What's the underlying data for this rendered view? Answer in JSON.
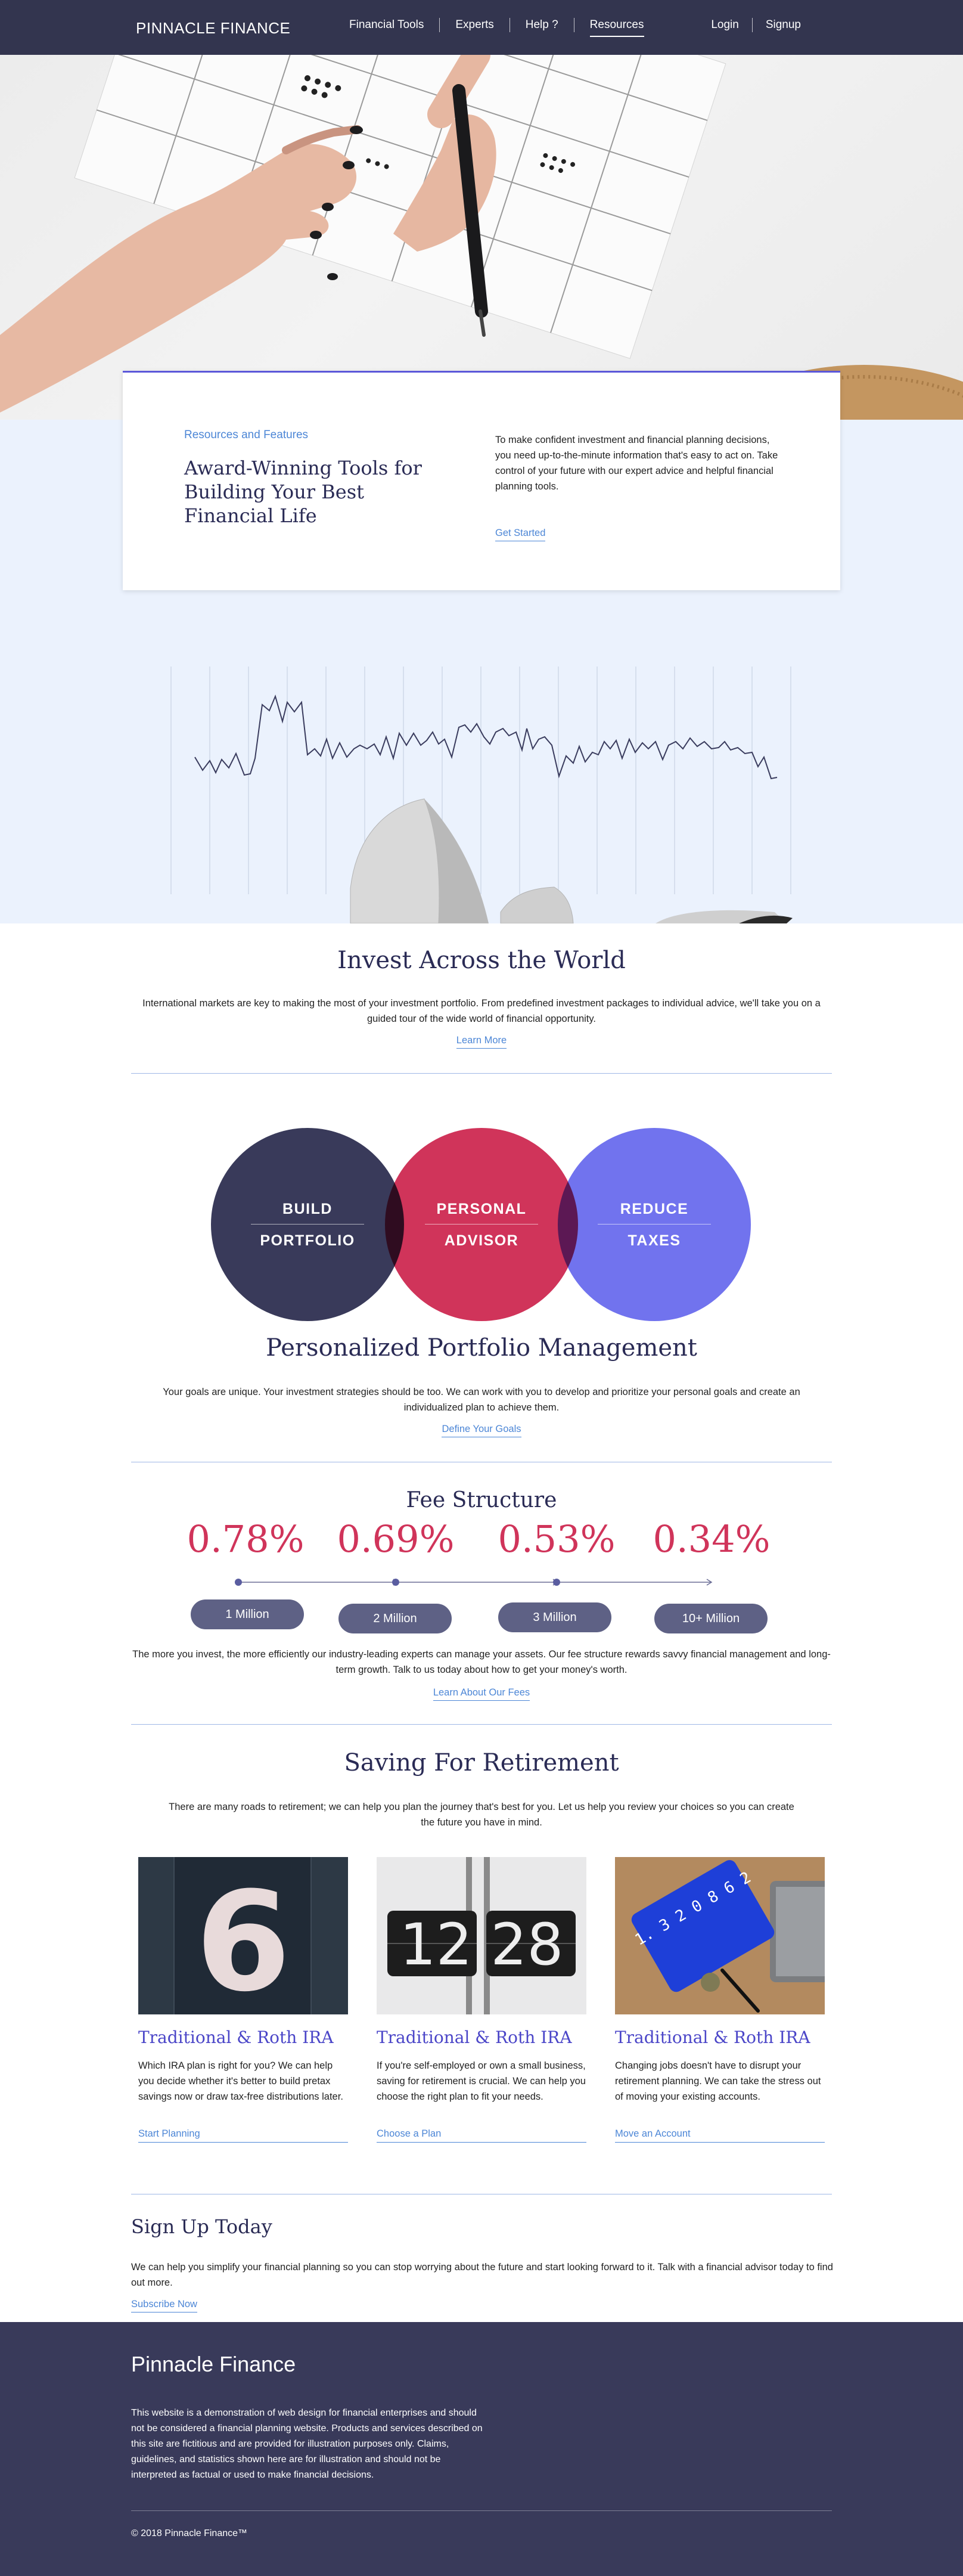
{
  "nav": {
    "brand": "PINNACLE FINANCE",
    "links": [
      "Financial Tools",
      "Experts",
      "Help ?",
      "Resources"
    ],
    "active": "Resources",
    "login": "Login",
    "signup": "Signup"
  },
  "feature": {
    "eyebrow": "Resources and Features",
    "title": "Award-Winning Tools for Building Your Best Financial Life",
    "text": "To make confident investment and financial planning decisions, you need up-to-the-minute information that's easy to act on. Take control of your future with our expert advice and helpful financial planning tools.",
    "link": "Get Started"
  },
  "invest": {
    "title": "Invest Across the World",
    "text": "International markets are key to making the most of your investment portfolio. From predefined investment packages to individual advice, we'll take you on a guided tour of the wide world of financial opportunity.",
    "link": "Learn More"
  },
  "circles": [
    {
      "line1": "BUILD",
      "line2": "PORTFOLIO",
      "color": "#393a5a"
    },
    {
      "line1": "PERSONAL",
      "line2": "ADVISOR",
      "color": "#d0345a"
    },
    {
      "line1": "REDUCE",
      "line2": "TAXES",
      "color": "#7173ee"
    }
  ],
  "portfolio": {
    "title": "Personalized Portfolio Management",
    "text": "Your goals are unique. Your investment strategies should be too. We can work with you to develop and prioritize your personal goals and create an individualized plan to achieve them.",
    "link": "Define Your Goals"
  },
  "fees": {
    "title": "Fee Structure",
    "rates": [
      "0.78%",
      "0.69%",
      "0.53%",
      "0.34%"
    ],
    "tiers": [
      "1 Million",
      "2 Million",
      "3 Million",
      "10+ Million"
    ],
    "text": "The more you invest, the more efficiently our industry-leading experts can manage your assets. Our fee structure rewards savvy financial management and long-term growth. Talk to us today about how to get your money's worth.",
    "link": "Learn About Our Fees"
  },
  "retirement": {
    "title": "Saving For Retirement",
    "text": "There are many roads to retirement; we can help you plan the journey that's best for you. Let us help you review your choices so you can create the future you have in mind.",
    "cards": [
      {
        "title": "Traditional & Roth IRA",
        "text": "Which IRA plan is right for you? We can help you decide whether it's better to build pretax savings now or draw tax-free distributions later.",
        "link": "Start Planning",
        "image_digits": "6"
      },
      {
        "title": "Traditional & Roth IRA",
        "text": "If you're self-employed or own a small business, saving for retirement is crucial. We can help you choose the right plan to fit your needs.",
        "link": "Choose a Plan",
        "image_digits": "12 28"
      },
      {
        "title": "Traditional & Roth IRA",
        "text": "Changing jobs doesn't have to disrupt your retirement planning. We can take the stress out of moving your existing accounts.",
        "link": "Move an Account",
        "image_digits": "1. 3 2 0 8 6 2"
      }
    ]
  },
  "signup": {
    "title": "Sign Up Today",
    "text": "We can help you simplify your financial planning so you can stop worrying about the future and start looking forward to it. Talk with a financial advisor today to find out more.",
    "link": "Subscribe Now"
  },
  "footer": {
    "brand": "Pinnacle Finance",
    "disclaimer": "This website is a demonstration of web design for financial enterprises and should not be considered a financial planning website. Products and services described on this site are fictitious and are provided for illustration purposes only. Claims, guidelines, and statistics shown here are for illustration and should not be interpreted as factual or used to make financial decisions.",
    "copyright": "© 2018 Pinnacle Finance™"
  }
}
